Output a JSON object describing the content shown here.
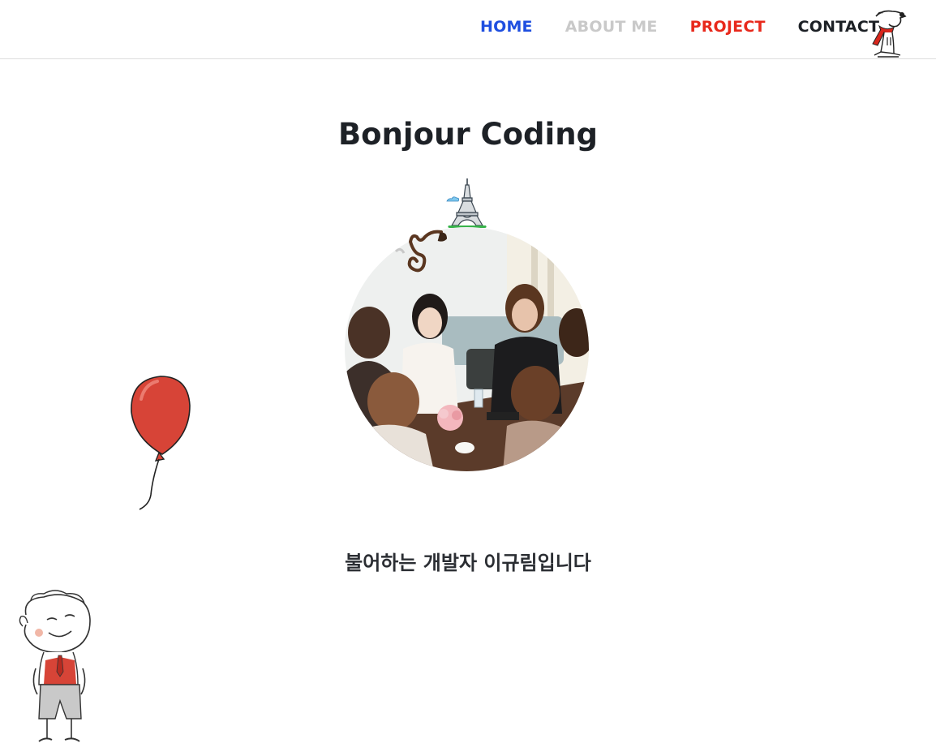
{
  "nav": {
    "items": [
      {
        "label": "HOME",
        "color": "#1f4fe0"
      },
      {
        "label": "ABOUT ME",
        "color": "#c9c9c9"
      },
      {
        "label": "PROJECT",
        "color": "#e8291c"
      },
      {
        "label": "CONTACT",
        "color": "#1d2126"
      }
    ],
    "logo_icon": "bear-with-red-scarf-illustration"
  },
  "hero": {
    "title": "Bonjour Coding",
    "eiffel_icon": "eiffel-tower-icon",
    "photo": "team-meeting-photo",
    "subtitle": "불어하는 개발자 이규림입니다"
  },
  "decorations": {
    "balloon": "red-balloon-illustration",
    "boy": "boy-illustration"
  },
  "colors": {
    "accent_blue": "#1f4fe0",
    "accent_red": "#e8291c",
    "muted": "#c9c9c9",
    "text": "#1d2126"
  }
}
